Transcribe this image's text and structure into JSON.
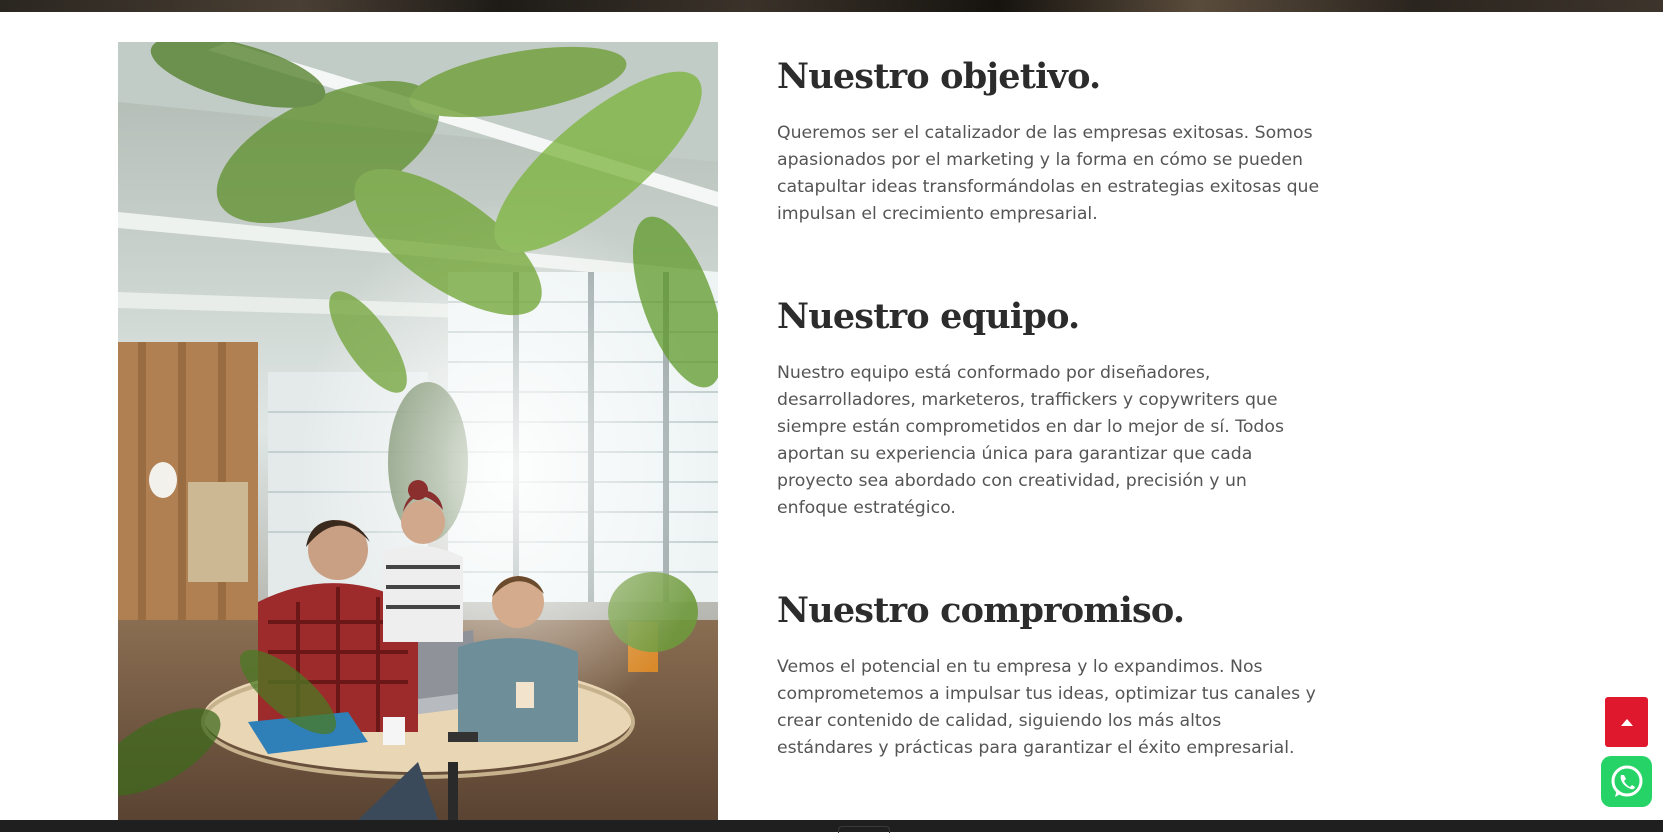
{
  "sections": [
    {
      "title": "Nuestro objetivo.",
      "body": "Queremos ser el catalizador de las empresas exitosas. Somos apasionados por el marketing y la forma en cómo se pueden catapultar ideas transformándolas en estrategias exitosas que impulsan el crecimiento empresarial."
    },
    {
      "title": "Nuestro equipo.",
      "body": "Nuestro equipo está conformado por diseñadores, desarrolladores, marketeros, traffickers y copywriters que siempre están comprometidos en dar lo mejor de sí. Todos aportan su experiencia única para garantizar que cada proyecto sea abordado con creatividad, precisión y un enfoque estratégico."
    },
    {
      "title": "Nuestro compromiso.",
      "body": "Vemos el potencial en tu empresa y lo expandimos. Nos comprometemos a impulsar tus ideas, optimizar tus canales y crear contenido de calidad, siguiendo los más altos estándares y prácticas para garantizar el éxito empresarial."
    }
  ],
  "floating": {
    "scroll_top_icon": "triangle-up-icon",
    "whatsapp_icon": "whatsapp-icon"
  },
  "colors": {
    "heading": "#2c2c2c",
    "body_text": "#555555",
    "scroll_top_bg": "#e0182e",
    "whatsapp_bg": "#25d366"
  }
}
